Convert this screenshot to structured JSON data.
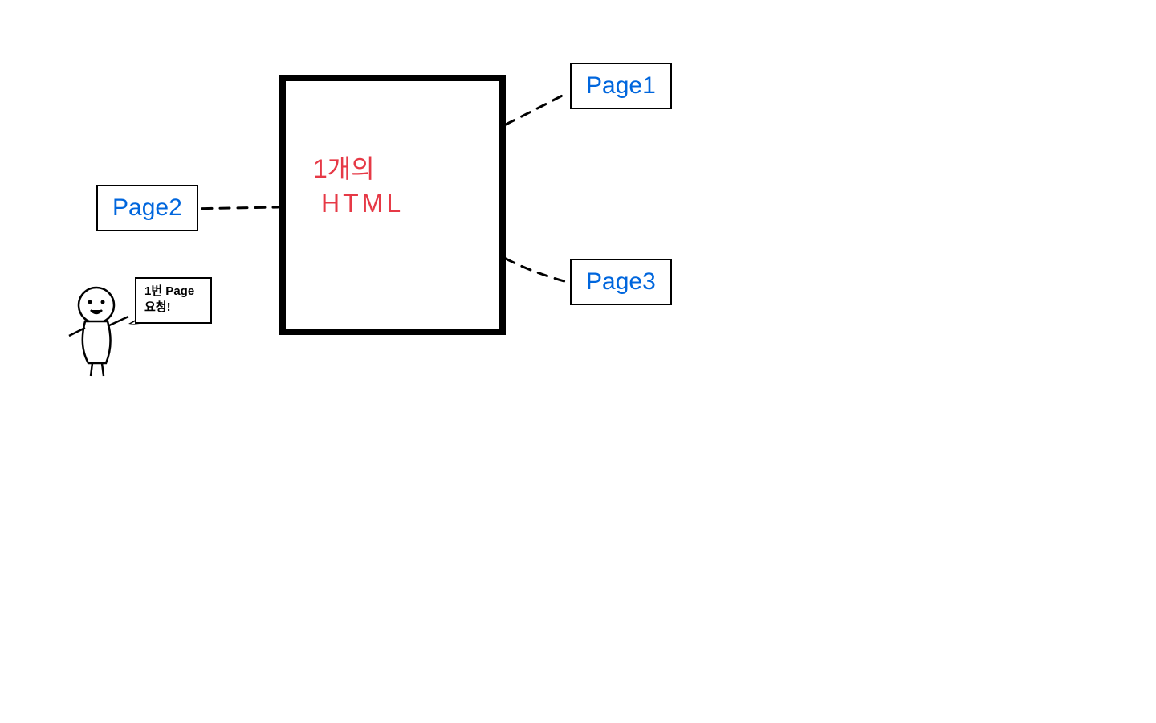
{
  "diagram": {
    "center": {
      "line1": "1개의",
      "line2": "HTML"
    },
    "labels": {
      "page1": "Page1",
      "page2": "Page2",
      "page3": "Page3"
    },
    "character": {
      "speech_line1": "1번 Page",
      "speech_line2": "요청!"
    }
  }
}
